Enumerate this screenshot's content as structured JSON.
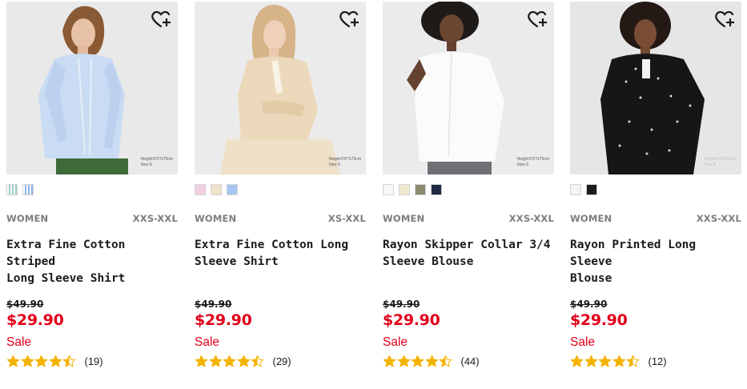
{
  "products": [
    {
      "gender": "WOMEN",
      "sizes": "XXS-XXL",
      "name_line1": "Extra Fine Cotton Striped",
      "name_line2": "Long Sleeve Shirt",
      "original_price": "$49.90",
      "sale_price": "$29.90",
      "sale_label": "Sale",
      "review_count": "(19)",
      "rating": 4.5,
      "caption_line1": "Height:5'9\"/175cm",
      "caption_line2": "Size:S",
      "favorite_icon": "heart-plus-icon",
      "swatches": [
        "#b7d3cf",
        "#a9c2e6"
      ]
    },
    {
      "gender": "WOMEN",
      "sizes": "XS-XXL",
      "name_line1": "Extra Fine Cotton Long",
      "name_line2": "Sleeve Shirt",
      "original_price": "$49.90",
      "sale_price": "$29.90",
      "sale_label": "Sale",
      "review_count": "(29)",
      "rating": 4.5,
      "caption_line1": "Height:5'8\"/173cm",
      "caption_line2": "Size:S",
      "favorite_icon": "heart-plus-icon",
      "swatches": [
        "#f1cfe0",
        "#efe2c9",
        "#a9c6f2"
      ]
    },
    {
      "gender": "WOMEN",
      "sizes": "XXS-XXL",
      "name_line1": "Rayon Skipper Collar 3/4",
      "name_line2": "Sleeve Blouse",
      "original_price": "$49.90",
      "sale_price": "$29.90",
      "sale_label": "Sale",
      "review_count": "(44)",
      "rating": 4.5,
      "caption_line1": "Height:5'9\"/175cm",
      "caption_line2": "Size:S",
      "favorite_icon": "heart-plus-icon",
      "swatches": [
        "#f7f7f7",
        "#efe8cf",
        "#8b8a6e",
        "#1f2a44"
      ]
    },
    {
      "gender": "WOMEN",
      "sizes": "XXS-XXL",
      "name_line1": "Rayon Printed Long Sleeve",
      "name_line2": "Blouse",
      "original_price": "$49.90",
      "sale_price": "$29.90",
      "sale_label": "Sale",
      "review_count": "(12)",
      "rating": 4.5,
      "caption_line1": "Height:5'8\"/173cm",
      "caption_line2": "Size:S",
      "favorite_icon": "heart-plus-icon",
      "swatches": [
        "#f4f4f4",
        "#1b1b1b"
      ]
    }
  ],
  "colors": {
    "sale_red": "#e1001a",
    "star_gold": "#f5b301",
    "meta_gray": "#7d7d7d"
  }
}
